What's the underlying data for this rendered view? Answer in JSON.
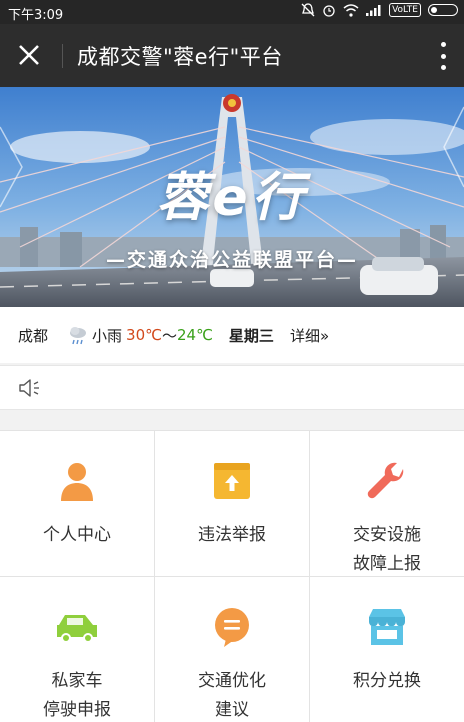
{
  "status_bar": {
    "time": "下午3:09",
    "network_badge": "VoLTE"
  },
  "title_bar": {
    "title": "成都交警\"蓉e行\"平台"
  },
  "banner": {
    "title": "蓉e行",
    "subtitle": "—交通众治公益联盟平台—"
  },
  "weather": {
    "city": "成都",
    "condition": "小雨",
    "temp_high": "30℃",
    "separator": "〜",
    "temp_low": "24℃",
    "weekday": "星期三",
    "detail_link": "详细»"
  },
  "grid": {
    "items": [
      {
        "label_line1": "个人中心",
        "label_line2": "",
        "icon": "person-icon",
        "color": "#f39a45"
      },
      {
        "label_line1": "违法举报",
        "label_line2": "",
        "icon": "upload-box-icon",
        "color": "#f5b731"
      },
      {
        "label_line1": "交安设施",
        "label_line2": "故障上报",
        "icon": "wrench-icon",
        "color": "#f06a5a"
      },
      {
        "label_line1": "私家车",
        "label_line2": "停驶申报",
        "icon": "car-icon",
        "color": "#8fcf3c"
      },
      {
        "label_line1": "交通优化",
        "label_line2": "建议",
        "icon": "speech-bubble-icon",
        "color": "#f39a45"
      },
      {
        "label_line1": "积分兑换",
        "label_line2": "",
        "icon": "shop-icon",
        "color": "#5bc3e6"
      }
    ]
  }
}
